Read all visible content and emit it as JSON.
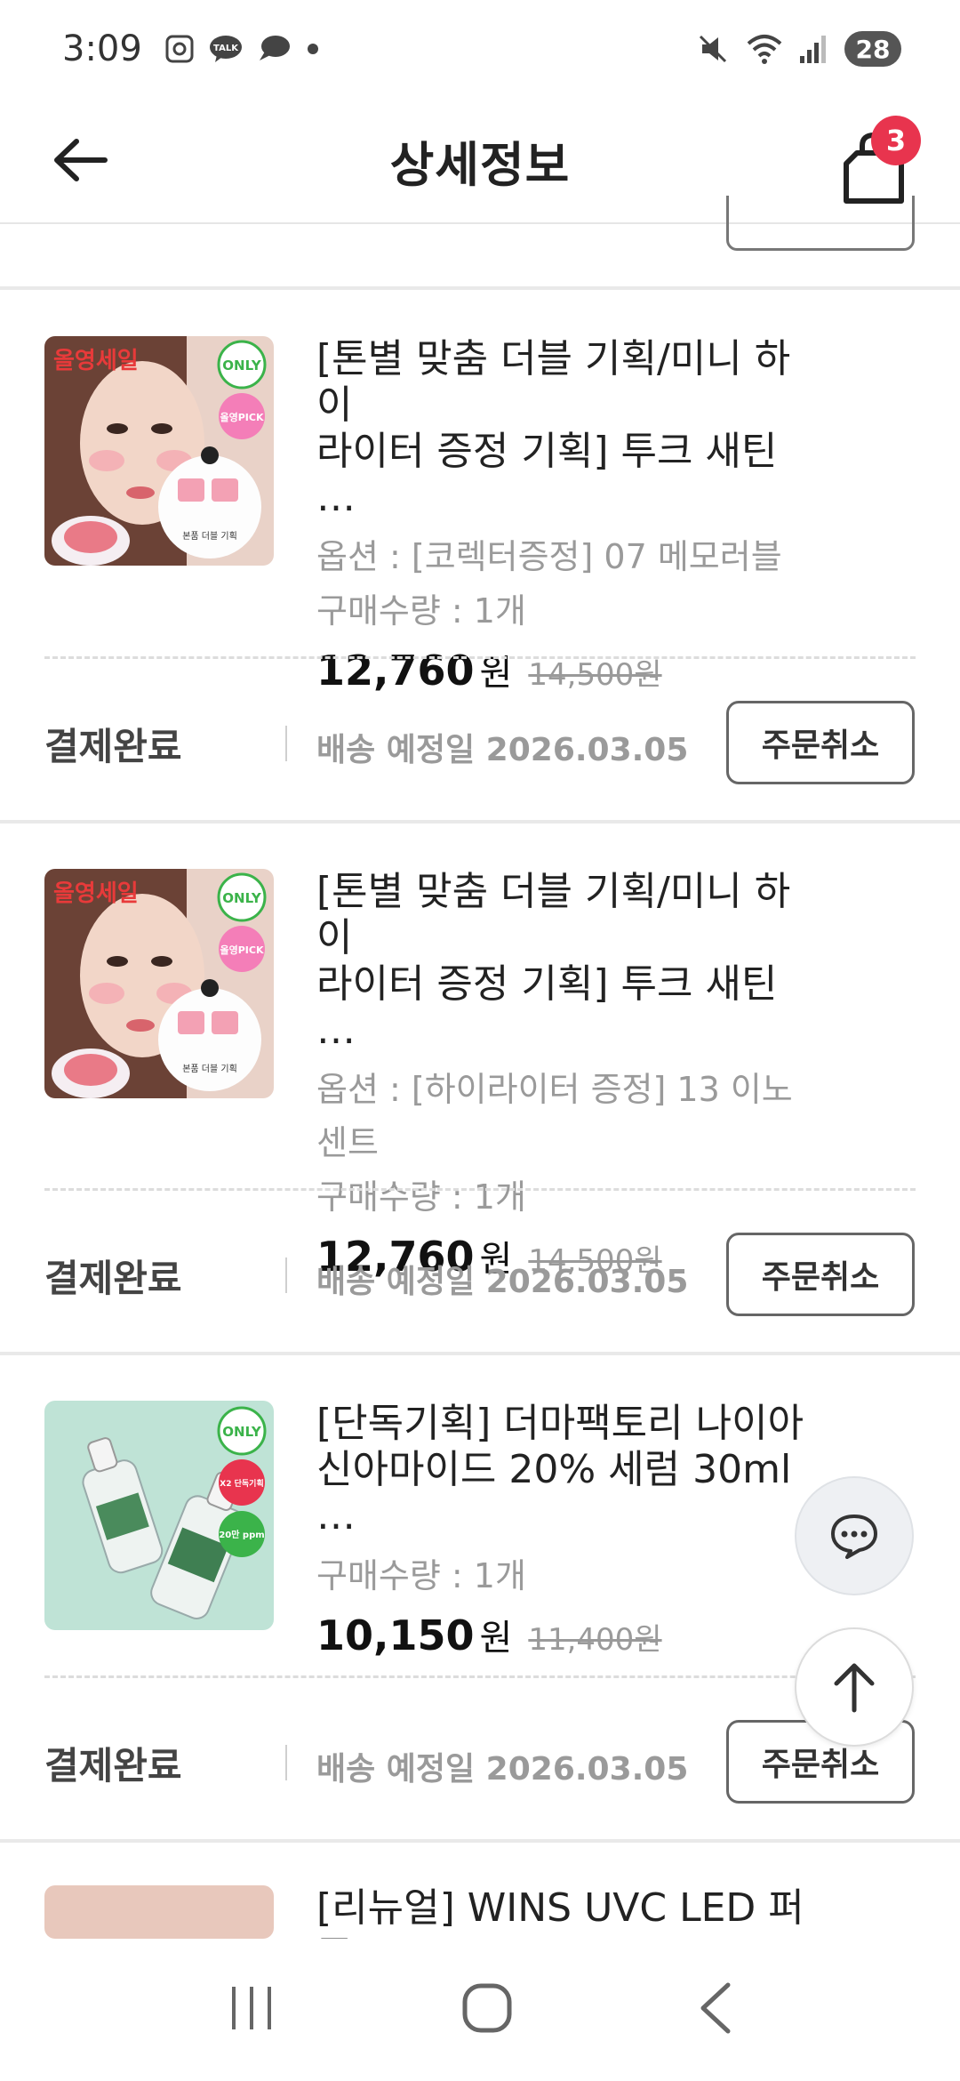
{
  "status_bar": {
    "time": "3:09",
    "battery": "28"
  },
  "header": {
    "title": "상세정보",
    "cart_count": "3"
  },
  "orders": [
    {
      "name_line1": "[톤별 맞춤 더블 기획/미니 하이",
      "name_line2": "라이터 증정 기획] 투크 새틴 …",
      "option": "옵션 : [코렉터증정] 07 메모러블",
      "qty": "구매수량 : 1개",
      "price": "12,760",
      "price_unit": "원",
      "original_price": "14,500원",
      "status": "결제완료",
      "shipping": "배송 예정일 2026.03.05",
      "cancel_label": "주문취소",
      "thumb_texts": [
        "올영세일",
        "ONLY",
        "올영PICK",
        "본품 더블 기획"
      ]
    },
    {
      "name_line1": "[톤별 맞춤 더블 기획/미니 하이",
      "name_line2": "라이터 증정 기획] 투크 새틴 …",
      "option": "옵션 : [하이라이터 증정] 13 이노센트",
      "qty": "구매수량 : 1개",
      "price": "12,760",
      "price_unit": "원",
      "original_price": "14,500원",
      "status": "결제완료",
      "shipping": "배송 예정일 2026.03.05",
      "cancel_label": "주문취소",
      "thumb_texts": [
        "올영세일",
        "ONLY",
        "올영PICK",
        "본품 더블 기획"
      ]
    },
    {
      "name_line1": "[단독기획] 더마팩토리 나이아",
      "name_line2": "신아마이드 20% 세럼 30ml …",
      "qty": "구매수량 : 1개",
      "price": "10,150",
      "price_unit": "원",
      "original_price": "11,400원",
      "status": "결제완료",
      "shipping": "배송 예정일 2026.03.05",
      "cancel_label": "주문취소",
      "thumb_texts": [
        "ONLY",
        "X2 단독기획",
        "20만 ppm"
      ]
    },
    {
      "name_line1": "[리뉴얼] WINS UVC LED 퍼프"
    }
  ],
  "colors": {
    "badge": "#e8344e",
    "muted": "#9a9a9a",
    "thumb_serum_bg": "#bfe3d6"
  },
  "icons": [
    "back-arrow-icon",
    "shopping-bag-icon",
    "chat-icon",
    "arrow-up-icon",
    "nav-recents-icon",
    "nav-home-icon",
    "nav-back-icon"
  ]
}
